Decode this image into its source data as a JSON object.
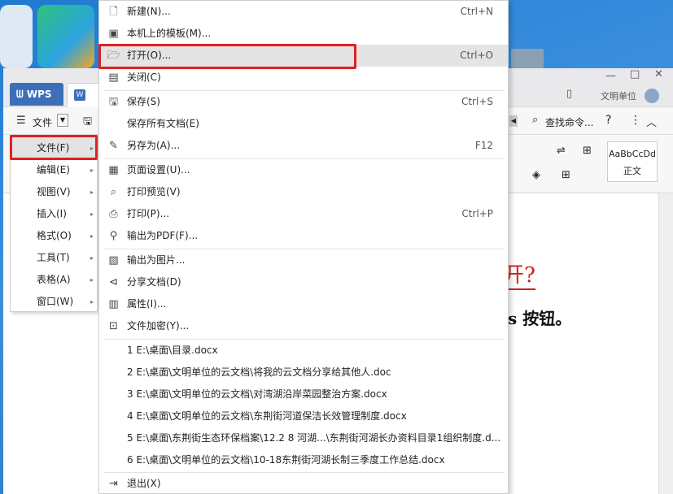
{
  "window": {
    "wps_tab": "WPS",
    "doc_tab": "W",
    "user_name": "文明单位",
    "search_command": "查找命令...",
    "file_menu_button": "文件",
    "style_preview": "AaBbCcDd",
    "style_name": "正文",
    "doc_text_heading": "开?",
    "doc_text_body": "s 按钮。"
  },
  "left_menu": {
    "items": [
      {
        "label": "文件(F)"
      },
      {
        "label": "编辑(E)"
      },
      {
        "label": "视图(V)"
      },
      {
        "label": "插入(I)"
      },
      {
        "label": "格式(O)"
      },
      {
        "label": "工具(T)"
      },
      {
        "label": "表格(A)"
      },
      {
        "label": "窗口(W)"
      }
    ]
  },
  "file_menu": {
    "items": [
      {
        "label": "新建(N)...",
        "shortcut": "Ctrl+N",
        "icon": "new-doc-icon"
      },
      {
        "label": "本机上的模板(M)...",
        "shortcut": "",
        "icon": "template-icon"
      },
      {
        "label": "打开(O)...",
        "shortcut": "Ctrl+O",
        "icon": "folder-open-icon"
      },
      {
        "label": "关闭(C)",
        "shortcut": "",
        "icon": "close-doc-icon"
      },
      {
        "label": "保存(S)",
        "shortcut": "Ctrl+S",
        "icon": "save-icon"
      },
      {
        "label": "保存所有文档(E)",
        "shortcut": "",
        "icon": ""
      },
      {
        "label": "另存为(A)...",
        "shortcut": "F12",
        "icon": "save-as-icon"
      },
      {
        "label": "页面设置(U)...",
        "shortcut": "",
        "icon": "page-setup-icon"
      },
      {
        "label": "打印预览(V)",
        "shortcut": "",
        "icon": "print-preview-icon"
      },
      {
        "label": "打印(P)...",
        "shortcut": "Ctrl+P",
        "icon": "printer-icon"
      },
      {
        "label": "输出为PDF(F)...",
        "shortcut": "",
        "icon": "pdf-icon"
      },
      {
        "label": "输出为图片...",
        "shortcut": "",
        "icon": "image-export-icon"
      },
      {
        "label": "分享文档(D)",
        "shortcut": "",
        "icon": "share-icon"
      },
      {
        "label": "属性(I)...",
        "shortcut": "",
        "icon": "properties-icon"
      },
      {
        "label": "文件加密(Y)...",
        "shortcut": "",
        "icon": "encrypt-icon"
      }
    ],
    "recent_files": [
      "1 E:\\桌面\\目录.docx",
      "2 E:\\桌面\\文明单位的云文档\\将我的云文档分享给其他人.doc",
      "3 E:\\桌面\\文明单位的云文档\\对湾湖沿岸菜园整治方案.docx",
      "4 E:\\桌面\\文明单位的云文档\\东荆街河道保洁长效管理制度.docx",
      "5 E:\\桌面\\东荆街生态环保档案\\12.2 8 河湖...\\东荆街河湖长办资料目录1组织制度.d...",
      "6 E:\\桌面\\文明单位的云文档\\10-18东荆街河湖长制三季度工作总结.docx"
    ],
    "exit_label": "退出(X)"
  },
  "colors": {
    "highlight_box": "#e02020",
    "wps_tab": "#3c6fb7",
    "menu_hover": "#e4e4e4"
  }
}
